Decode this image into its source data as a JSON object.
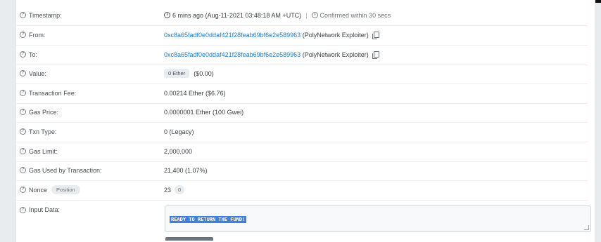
{
  "rows": [
    {
      "label": "Timestamp:"
    },
    {
      "label": "From:"
    },
    {
      "label": "To:"
    },
    {
      "label": "Value:"
    },
    {
      "label": "Transaction Fee:"
    },
    {
      "label": "Gas Price:"
    },
    {
      "label": "Txn Type:"
    },
    {
      "label": "Gas Limit:"
    },
    {
      "label": "Gas Used by Transaction:"
    },
    {
      "label": "Nonce"
    },
    {
      "label": "Input Data:"
    }
  ],
  "timestamp": {
    "relative": "6 mins ago (Aug-11-2021 03:48:18 AM +UTC)",
    "separator": "|",
    "confirmed": "Confirmed within 30 secs"
  },
  "from": {
    "address": "0xc8a65fadf0e0ddaf421f28feab69bf6e2e589963",
    "name": "(PolyNetwork Exploiter)"
  },
  "to": {
    "address": "0xc8a65fadf0e0ddaf421f28feab69bf6e2e589963",
    "name": "(PolyNetwork Exploiter)"
  },
  "value": {
    "badge": "0 Ether",
    "usd": "($0.00)"
  },
  "transaction_fee": "0.00214 Ether ($6.76)",
  "gas_price": "0.0000001 Ether (100 Gwei)",
  "txn_type": "0 (Legacy)",
  "gas_limit": "2,000,000",
  "gas_used": "21,400 (1.07%)",
  "nonce": {
    "badge": "Position",
    "value": "23",
    "position": "0"
  },
  "input_data": "READY TO RETURN THE FUND!",
  "icons": {
    "help": "question-circle-icon",
    "clock": "clock-icon",
    "copy": "copy-icon"
  }
}
